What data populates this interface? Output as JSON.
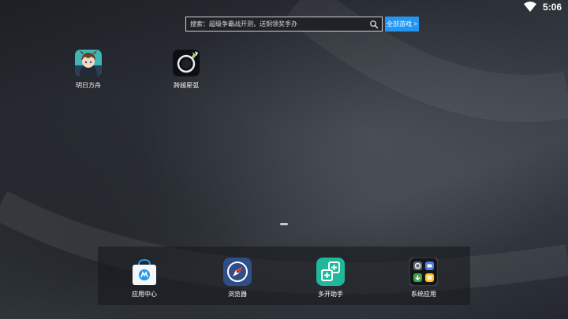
{
  "status_bar": {
    "time": "5:06",
    "wifi_icon": "wifi-icon"
  },
  "search": {
    "text": "搜索：超级争霸战开测，送铜领奖手办",
    "icon": "search-icon",
    "all_games_label": "全部游戏 >"
  },
  "desktop_apps": [
    {
      "label": "明日方舟",
      "icon": "arknights-app-icon"
    },
    {
      "label": "跨越星弧",
      "icon": "ring-planet-app-icon"
    }
  ],
  "dock": {
    "apps": [
      {
        "label": "应用中心",
        "icon": "app-center-bag-icon"
      },
      {
        "label": "浏览器",
        "icon": "compass-browser-icon"
      },
      {
        "label": "多开助手",
        "icon": "multi-open-icon"
      },
      {
        "label": "系统应用",
        "icon": "system-apps-folder-icon"
      }
    ]
  },
  "colors": {
    "accent": "#2196f3",
    "multi_open_green": "#1fb89a",
    "browser_blue": "#2f4d86"
  }
}
